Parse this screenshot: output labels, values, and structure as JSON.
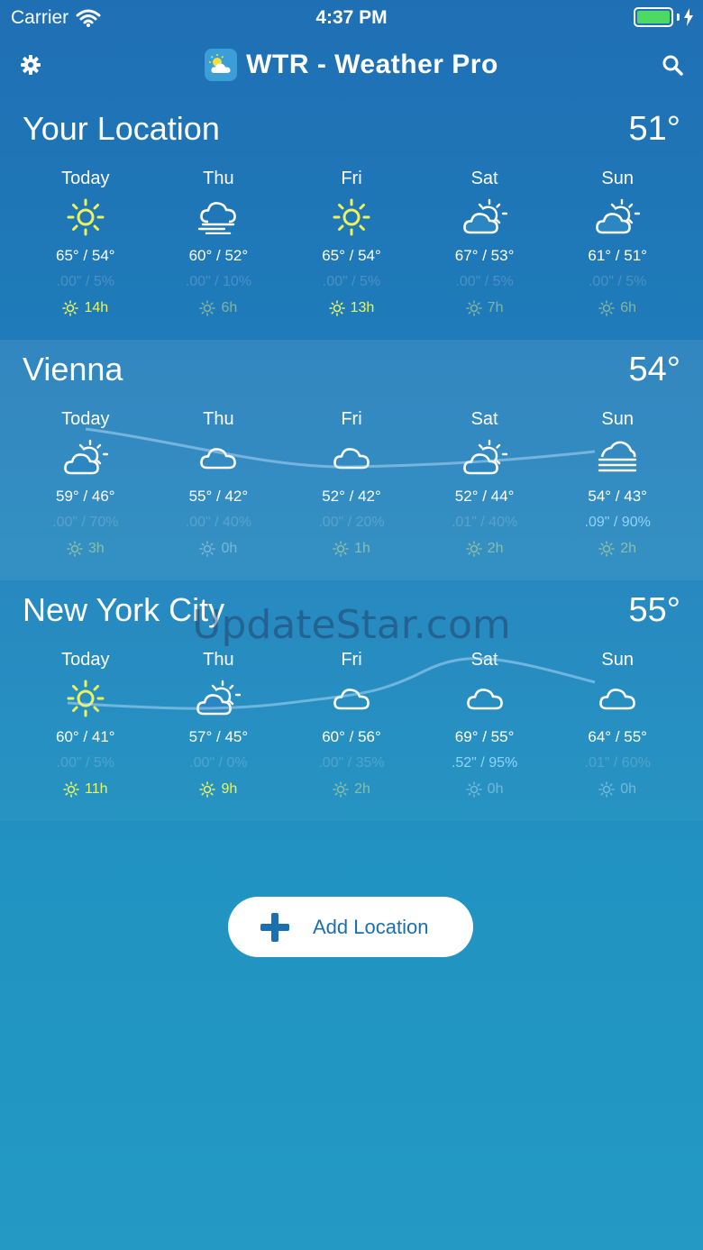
{
  "status": {
    "carrier": "Carrier",
    "time": "4:37 PM"
  },
  "nav": {
    "title": "WTR - Weather Pro"
  },
  "locations": [
    {
      "name": "Your Location",
      "temp": "51°",
      "days": [
        {
          "name": "Today",
          "icon": "sun-icon",
          "hilo": "65° / 54°",
          "precip": ".00\" / 5%",
          "sun": "14h",
          "sun_style": "bright"
        },
        {
          "name": "Thu",
          "icon": "cloud-fog-icon",
          "hilo": "60° / 52°",
          "precip": ".00\" / 10%",
          "sun": "6h",
          "sun_style": "dim"
        },
        {
          "name": "Fri",
          "icon": "sun-icon",
          "hilo": "65° / 54°",
          "precip": ".00\" / 5%",
          "sun": "13h",
          "sun_style": "bright"
        },
        {
          "name": "Sat",
          "icon": "partly-cloudy-icon",
          "hilo": "67° / 53°",
          "precip": ".00\" / 5%",
          "sun": "7h",
          "sun_style": "dim"
        },
        {
          "name": "Sun",
          "icon": "partly-cloudy-icon",
          "hilo": "61° / 51°",
          "precip": ".00\" / 5%",
          "sun": "6h",
          "sun_style": "dim"
        }
      ]
    },
    {
      "name": "Vienna",
      "temp": "54°",
      "days": [
        {
          "name": "Today",
          "icon": "partly-cloudy-icon",
          "hilo": "59° / 46°",
          "precip": ".00\" / 70%",
          "sun": "3h",
          "sun_style": "dim"
        },
        {
          "name": "Thu",
          "icon": "cloud-icon",
          "hilo": "55° / 42°",
          "precip": ".00\" / 40%",
          "sun": "0h",
          "sun_style": "off"
        },
        {
          "name": "Fri",
          "icon": "cloud-icon",
          "hilo": "52° / 42°",
          "precip": ".00\" / 20%",
          "sun": "1h",
          "sun_style": "dim"
        },
        {
          "name": "Sat",
          "icon": "partly-cloudy-icon",
          "hilo": "52° / 44°",
          "precip": ".01\" / 40%",
          "sun": "2h",
          "sun_style": "dim"
        },
        {
          "name": "Sun",
          "icon": "fog-icon",
          "hilo": "54° / 43°",
          "precip": ".09\" / 90%",
          "wet": true,
          "sun": "2h",
          "sun_style": "dim"
        }
      ]
    },
    {
      "name": "New York City",
      "temp": "55°",
      "days": [
        {
          "name": "Today",
          "icon": "sun-icon",
          "hilo": "60° / 41°",
          "precip": ".00\" / 5%",
          "sun": "11h",
          "sun_style": "bright"
        },
        {
          "name": "Thu",
          "icon": "partly-cloudy-icon",
          "hilo": "57° / 45°",
          "precip": ".00\" / 0%",
          "sun": "9h",
          "sun_style": "bright"
        },
        {
          "name": "Fri",
          "icon": "cloud-icon",
          "hilo": "60° / 56°",
          "precip": ".00\" / 35%",
          "sun": "2h",
          "sun_style": "dim"
        },
        {
          "name": "Sat",
          "icon": "cloud-icon",
          "hilo": "69° / 55°",
          "precip": ".52\" / 95%",
          "wet": true,
          "sun": "0h",
          "sun_style": "off"
        },
        {
          "name": "Sun",
          "icon": "cloud-icon",
          "hilo": "64° / 55°",
          "precip": ".01\" / 60%",
          "sun": "0h",
          "sun_style": "off"
        }
      ]
    }
  ],
  "watermark": "UpdateStar.com",
  "add_location": {
    "label": "Add Location"
  }
}
